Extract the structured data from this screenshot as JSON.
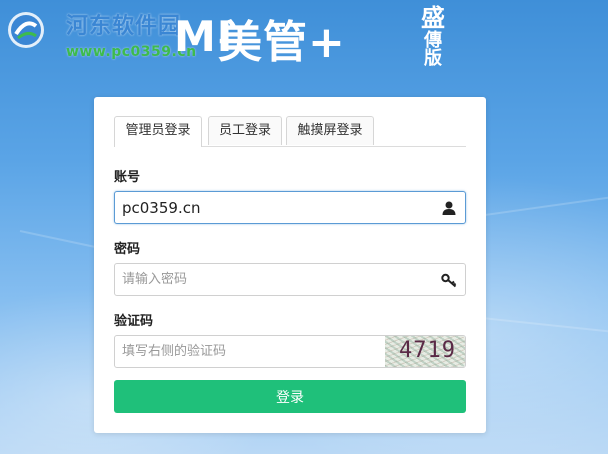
{
  "watermark": {
    "site_name": "河东软件园",
    "url": "www.pc0359.cn",
    "logo_icon": "pc0359-logo-icon"
  },
  "brand": {
    "mark": "MI",
    "name": "美管+",
    "sub_top": "盛",
    "sub_bottom": "傳版"
  },
  "login": {
    "tabs": [
      {
        "label": "管理员登录",
        "active": true
      },
      {
        "label": "员工登录",
        "active": false
      },
      {
        "label": "触摸屏登录",
        "active": false
      }
    ],
    "account": {
      "label": "账号",
      "value": "pc0359.cn",
      "icon": "user-icon"
    },
    "password": {
      "label": "密码",
      "placeholder": "请输入密码",
      "icon": "key-icon"
    },
    "captcha": {
      "label": "验证码",
      "placeholder": "填写右侧的验证码",
      "code": "4719"
    },
    "submit_label": "登录"
  },
  "colors": {
    "background_top": "#3f8fd8",
    "accent_button": "#1fc07a",
    "focus_border": "#5b9bd5"
  }
}
